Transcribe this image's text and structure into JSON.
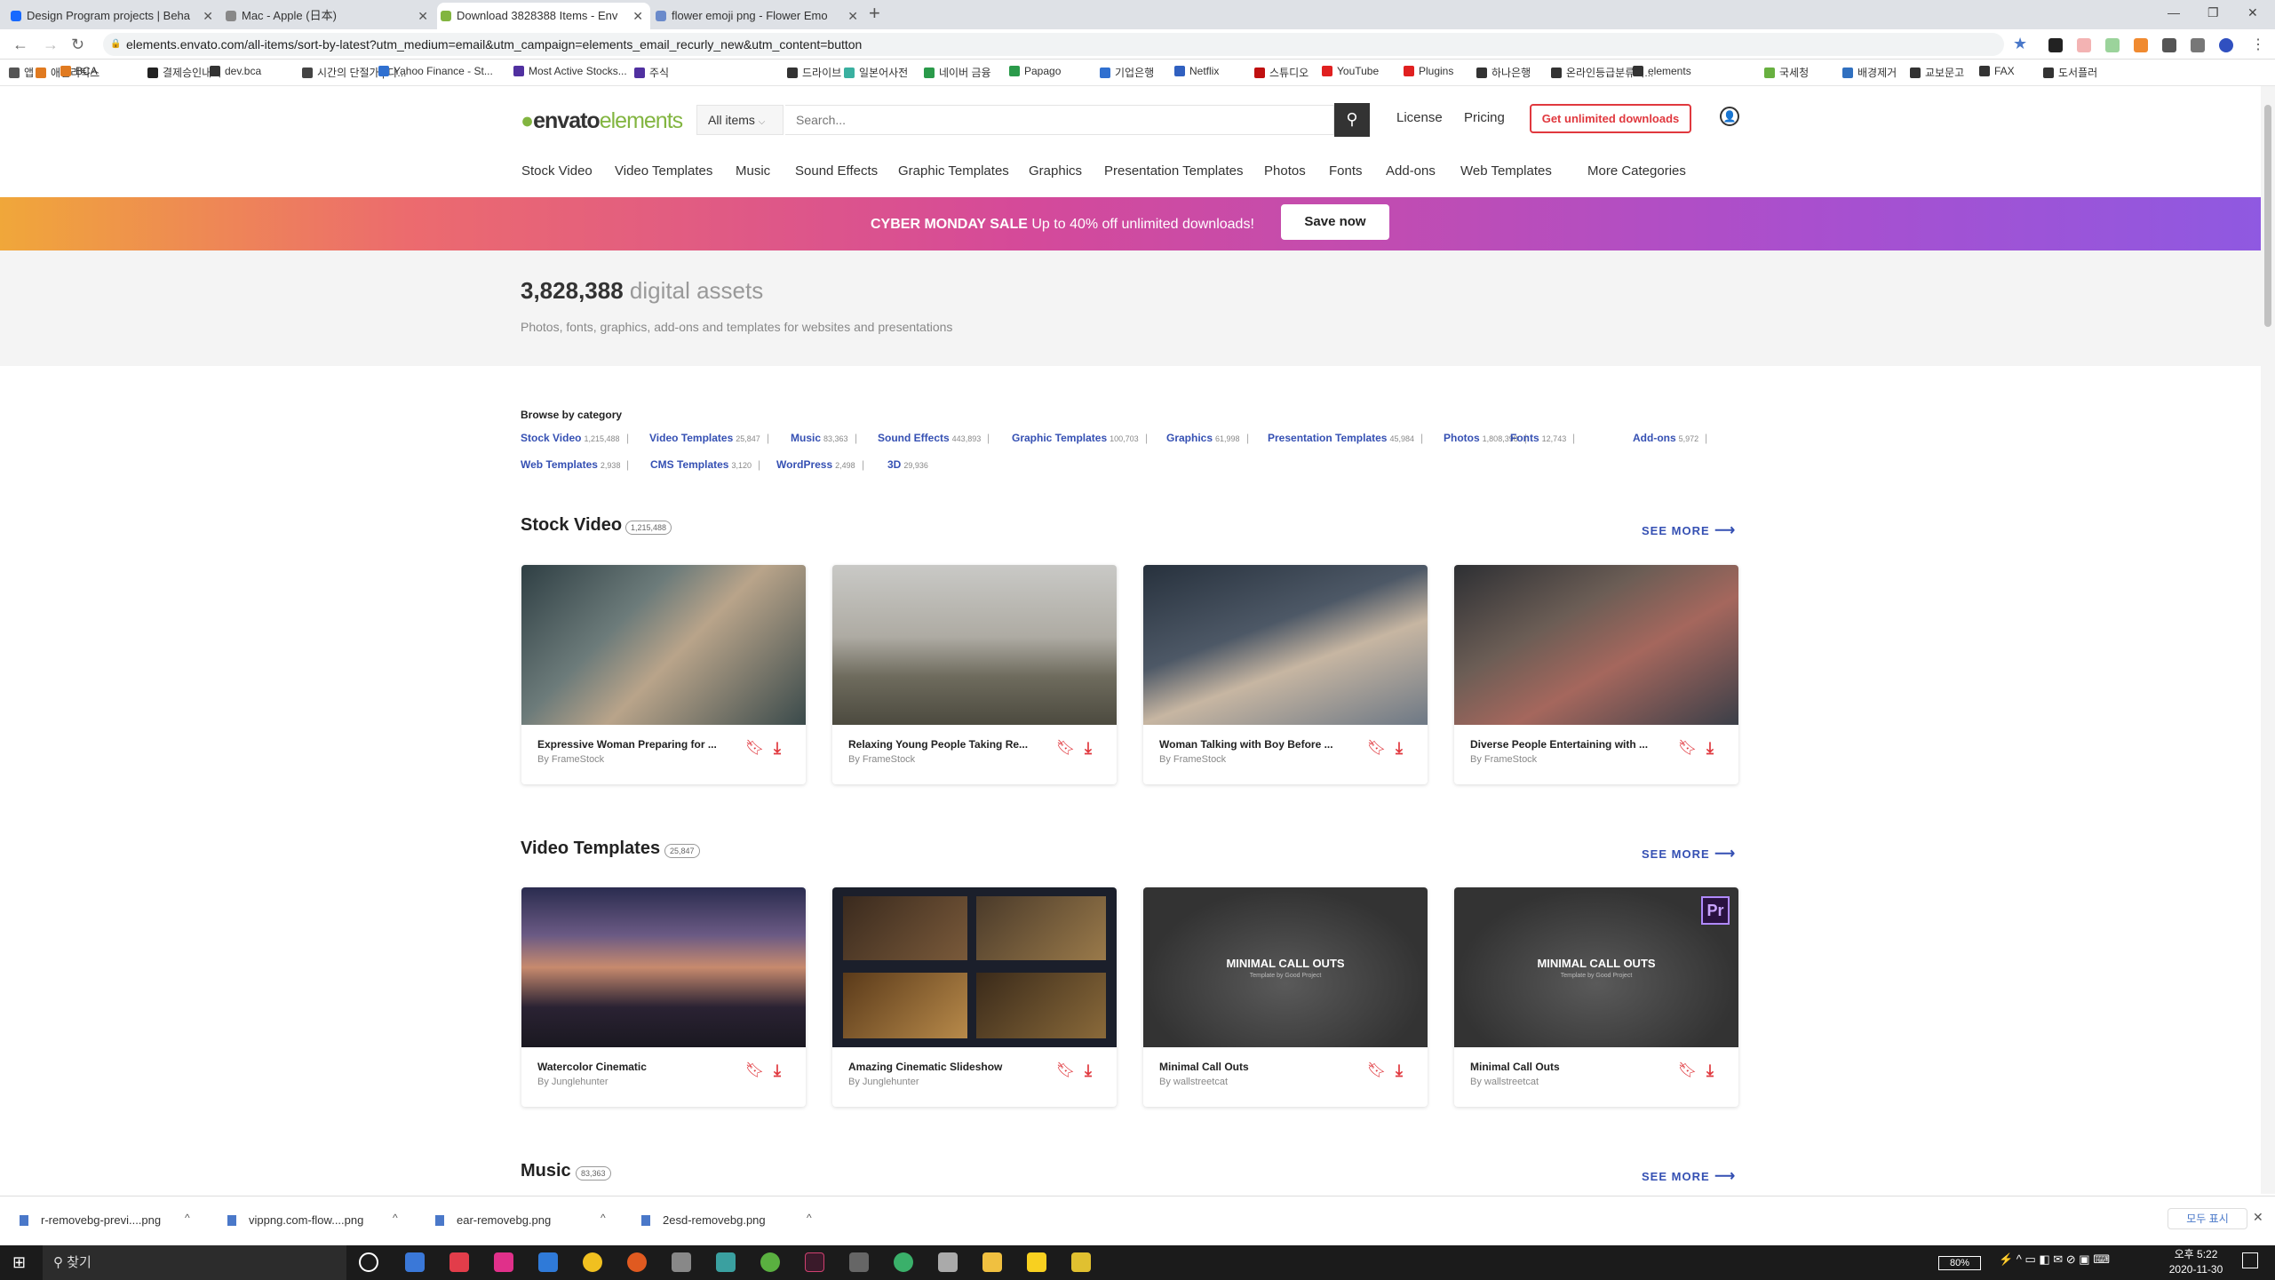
{
  "browser": {
    "tabs": [
      {
        "title": "Design Program projects | Beha"
      },
      {
        "title": "Mac - Apple (日本)"
      },
      {
        "title": "Download 3828388 Items - Env"
      },
      {
        "title": "flower emoji png - Flower Emo"
      }
    ],
    "url": "elements.envato.com/all-items/sort-by-latest?utm_medium=email&utm_campaign=elements_email_recurly_new&utm_content=button",
    "bookmarks": [
      "앱",
      "애널리틱스",
      "BCA",
      "결제승인내역",
      "dev.bca",
      "시간의 단절가 | 다...",
      "Yahoo Finance - St...",
      "Most Active Stocks...",
      "주식",
      "드라이브",
      "일본어사전",
      "네이버 금융",
      "Papago",
      "기업은행",
      "Netflix",
      "스튜디오",
      "YouTube",
      "Plugins",
      "하나은행",
      "온라인등급분류서...",
      "elements",
      "국세청",
      "배경제거",
      "교보문고",
      "FAX",
      "도서플러"
    ]
  },
  "header": {
    "logo_main": "envato",
    "logo_sub": "elements",
    "all_items": "All items",
    "search_placeholder": "Search...",
    "license": "License",
    "pricing": "Pricing",
    "cta": "Get unlimited downloads"
  },
  "categories": [
    "Stock Video",
    "Video Templates",
    "Music",
    "Sound Effects",
    "Graphic Templates",
    "Graphics",
    "Presentation Templates",
    "Photos",
    "Fonts",
    "Add-ons",
    "Web Templates",
    "More Categories"
  ],
  "banner": {
    "bold": "CYBER MONDAY SALE",
    "text": "Up to 40% off unlimited downloads!",
    "button": "Save now"
  },
  "hero": {
    "count": "3,828,388",
    "suffix": "digital assets",
    "subtitle": "Photos, fonts, graphics, add-ons and templates for websites and presentations"
  },
  "browse": {
    "label": "Browse by category",
    "row1": [
      {
        "name": "Stock Video",
        "count": "1,215,488"
      },
      {
        "name": "Video Templates",
        "count": "25,847"
      },
      {
        "name": "Music",
        "count": "83,363"
      },
      {
        "name": "Sound Effects",
        "count": "443,893"
      },
      {
        "name": "Graphic Templates",
        "count": "100,703"
      },
      {
        "name": "Graphics",
        "count": "61,998"
      },
      {
        "name": "Presentation Templates",
        "count": "45,984"
      },
      {
        "name": "Photos",
        "count": "1,808,398"
      },
      {
        "name": "Fonts",
        "count": "12,743"
      },
      {
        "name": "Add-ons",
        "count": "5,972"
      }
    ],
    "row2": [
      {
        "name": "Web Templates",
        "count": "2,938"
      },
      {
        "name": "CMS Templates",
        "count": "3,120"
      },
      {
        "name": "WordPress",
        "count": "2,498"
      },
      {
        "name": "3D",
        "count": "29,936"
      }
    ]
  },
  "sections": {
    "stock_video": {
      "title": "Stock Video",
      "badge": "1,215,488",
      "see_more": "SEE MORE",
      "items": [
        {
          "title": "Expressive Woman Preparing for ...",
          "author": "By FrameStock"
        },
        {
          "title": "Relaxing Young People Taking Re...",
          "author": "By FrameStock"
        },
        {
          "title": "Woman Talking with Boy Before ...",
          "author": "By FrameStock"
        },
        {
          "title": "Diverse People Entertaining with ...",
          "author": "By FrameStock"
        }
      ]
    },
    "video_templates": {
      "title": "Video Templates",
      "badge": "25,847",
      "see_more": "SEE MORE",
      "items": [
        {
          "title": "Watercolor Cinematic",
          "author": "By Junglehunter"
        },
        {
          "title": "Amazing Cinematic Slideshow",
          "author": "By Junglehunter"
        },
        {
          "title": "Minimal Call Outs",
          "author": "By wallstreetcat",
          "thumb_text": "MINIMAL CALL OUTS",
          "thumb_sub": "Template by Good Project"
        },
        {
          "title": "Minimal Call Outs",
          "author": "By wallstreetcat",
          "thumb_text": "MINIMAL CALL OUTS",
          "thumb_sub": "Template by Good Project"
        }
      ],
      "pr_badge": "Pr"
    },
    "music": {
      "title": "Music",
      "badge": "83,363",
      "see_more": "SEE MORE"
    }
  },
  "downloads": {
    "items": [
      "r-removebg-previ....png",
      "vippng.com-flow....png",
      "ear-removebg.png",
      "2esd-removebg.png"
    ],
    "show_all": "모두 표시"
  },
  "taskbar": {
    "search": "찾기",
    "battery": "80%",
    "time": "오후 5:22",
    "date": "2020-11-30"
  }
}
